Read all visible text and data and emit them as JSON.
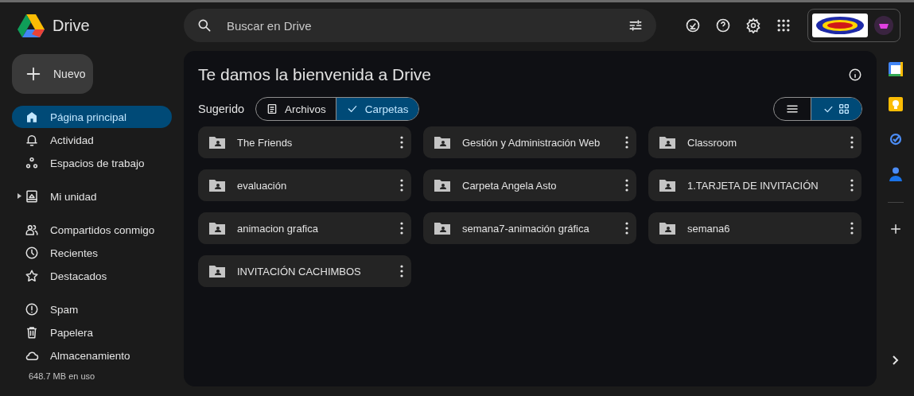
{
  "app": {
    "name": "Drive"
  },
  "search": {
    "placeholder": "Buscar en Drive"
  },
  "new_button": {
    "label": "Nuevo"
  },
  "sidebar": {
    "groups": [
      [
        {
          "label": "Página principal",
          "kind": "home",
          "selected": true
        },
        {
          "label": "Actividad",
          "kind": "bell",
          "selected": false
        },
        {
          "label": "Espacios de trabajo",
          "kind": "spaces",
          "selected": false
        }
      ],
      [
        {
          "label": "Mi unidad",
          "kind": "drive",
          "selected": false,
          "expanded": false
        }
      ],
      [
        {
          "label": "Compartidos conmigo",
          "kind": "shared",
          "selected": false
        },
        {
          "label": "Recientes",
          "kind": "clock",
          "selected": false
        },
        {
          "label": "Destacados",
          "kind": "star",
          "selected": false
        }
      ],
      [
        {
          "label": "Spam",
          "kind": "spam",
          "selected": false
        },
        {
          "label": "Papelera",
          "kind": "trash",
          "selected": false
        },
        {
          "label": "Almacenamiento",
          "kind": "cloud",
          "selected": false
        }
      ]
    ],
    "storage": "648.7 MB en uso"
  },
  "main": {
    "title": "Te damos la bienvenida a Drive",
    "filter_label": "Sugerido",
    "filters": [
      {
        "label": "Archivos",
        "selected": false
      },
      {
        "label": "Carpetas",
        "selected": true
      }
    ],
    "view_toggle": [
      {
        "kind": "list",
        "selected": false
      },
      {
        "kind": "grid",
        "selected": true
      }
    ],
    "folders": [
      {
        "name": "The Friends"
      },
      {
        "name": "Gestión y Administración Web"
      },
      {
        "name": "Classroom"
      },
      {
        "name": "evaluación"
      },
      {
        "name": "Carpeta Angela Asto"
      },
      {
        "name": "1.TARJETA DE INVITACIÓN"
      },
      {
        "name": "animacion grafica"
      },
      {
        "name": "semana7-animación gráfica"
      },
      {
        "name": "semana6"
      },
      {
        "name": "INVITACIÓN CACHIMBOS"
      }
    ]
  }
}
